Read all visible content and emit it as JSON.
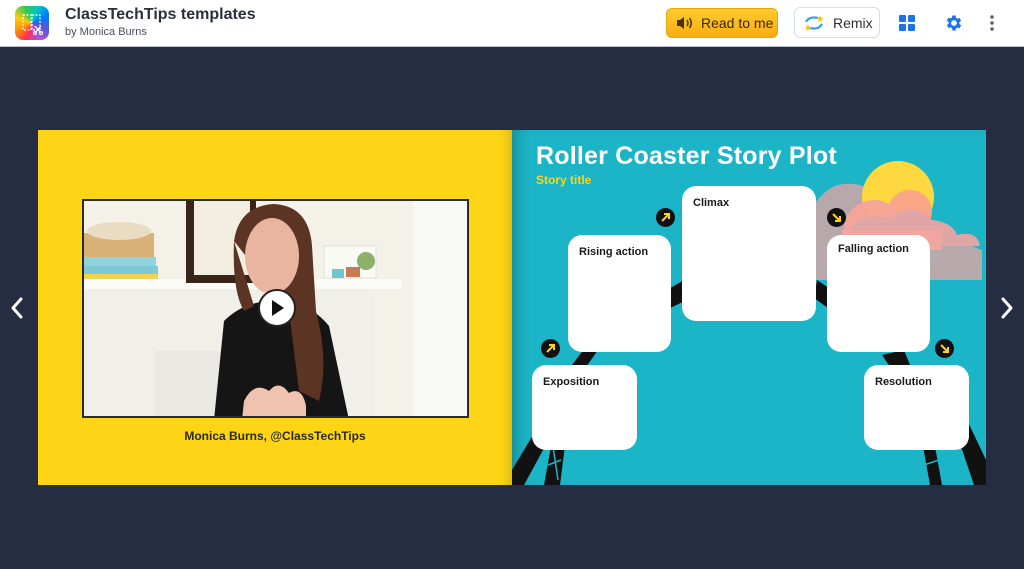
{
  "header": {
    "title": "ClassTechTips templates",
    "author": "by Monica Burns",
    "logo_icon": "book-creator-logo-icon",
    "read_to_me_label": "Read to me",
    "remix_label": "Remix",
    "icons": [
      "speaker-icon",
      "remix-stars-icon",
      "grid-view-icon",
      "gear-icon",
      "more-vertical-icon"
    ]
  },
  "navigation": {
    "prev_icon": "chevron-left-icon",
    "next_icon": "chevron-right-icon"
  },
  "left_page": {
    "background_color": "#fdd516",
    "video_caption": "Monica Burns, @ClassTechTips",
    "play_icon": "play-icon"
  },
  "right_page": {
    "background_color": "#1cb4c7",
    "title": "Roller Coaster Story Plot",
    "subtitle": "Story title",
    "cards": [
      {
        "label": "Exposition"
      },
      {
        "label": "Rising action"
      },
      {
        "label": "Climax"
      },
      {
        "label": "Falling action"
      },
      {
        "label": "Resolution"
      }
    ],
    "arrow_icons": [
      "arrow-up-right-icon",
      "arrow-up-right-icon",
      "arrow-down-right-icon",
      "arrow-down-right-icon"
    ]
  },
  "colors": {
    "stage_background": "#262c42",
    "read_button": "#fbbf1c",
    "accent_blue": "#1a73e8"
  }
}
